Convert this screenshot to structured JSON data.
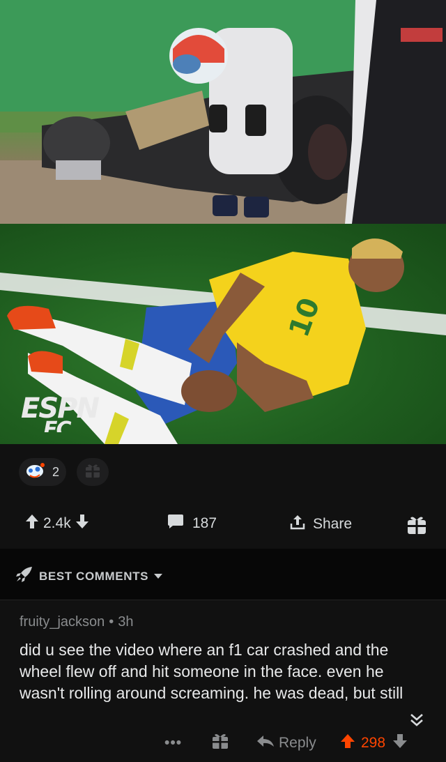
{
  "post": {
    "top_image": {
      "alt_icon": "f1-crash-photo"
    },
    "bottom_image": {
      "watermark_line1": "ESPN",
      "watermark_line2": "FC"
    }
  },
  "awards": {
    "count": "2"
  },
  "actions": {
    "upvotes": "2.4k",
    "comments": "187",
    "share": "Share"
  },
  "sort": {
    "label": "BEST COMMENTS"
  },
  "comment": {
    "author": "fruity_jackson",
    "separator": "•",
    "age": "3h",
    "body": "did u see the video where an f1 car crashed and the wheel flew off and hit someone in the face. even he wasn't rolling around screaming. he was dead, but still",
    "more": "•••",
    "reply": "Reply",
    "score": "298"
  },
  "colors": {
    "accent": "#ff4500",
    "background": "#111111"
  }
}
